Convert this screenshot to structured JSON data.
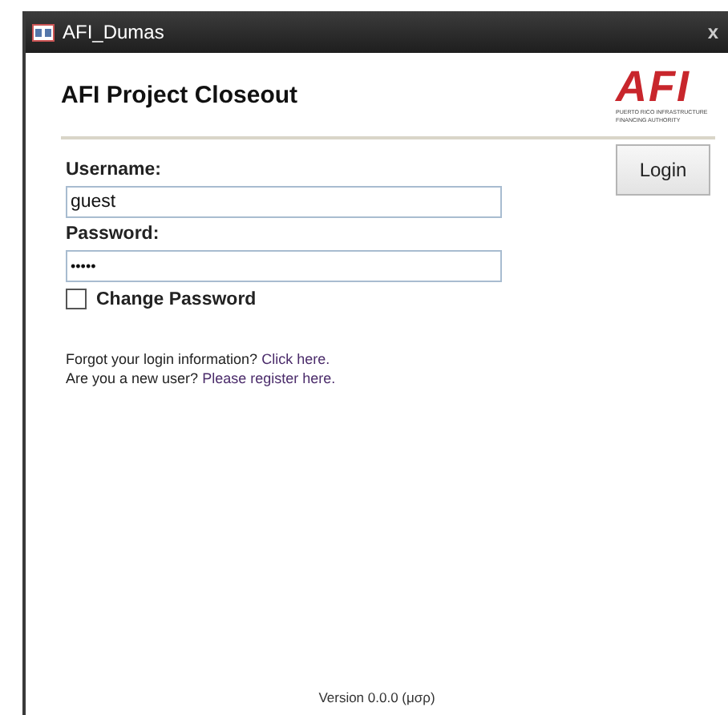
{
  "window": {
    "title": "AFI_Dumas",
    "close": "x"
  },
  "header": {
    "title": "AFI Project Closeout",
    "logo": {
      "mark": "AFI",
      "caption_lines": [
        "PUERTO RICO INFRASTRUCTURE",
        "FINANCING AUTHORITY"
      ]
    }
  },
  "form": {
    "username_label": "Username:",
    "username_value": "guest",
    "password_label": "Password:",
    "password_value": "•••••",
    "change_password": {
      "label": "Change Password",
      "checked": false
    }
  },
  "login_button": "Login",
  "help_lines": [
    {
      "prompt": "Forgot your login information?",
      "link": "Click here."
    },
    {
      "prompt": "Are you a new user?",
      "link": "Please register here."
    }
  ],
  "version": "Version 0.0.0 (μσρ)"
}
